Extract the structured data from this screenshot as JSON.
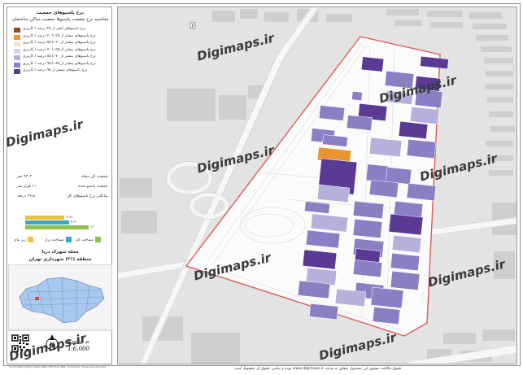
{
  "legend": {
    "title": "نرخ پاسیوهای جمعیت",
    "subtitle": "محاسبه نرخ جمعیت پاسیوها جمعیت ساکن ساختمان",
    "items": [
      {
        "label": "نرخ پاسیوهای کمتر از ۲۵ درصد / کاربری",
        "color": "#9a4a1a"
      },
      {
        "label": "نرخ پاسیوهای بیشتر از ۲۵ تا ۴۰ درصد / کاربری",
        "color": "#e8962e"
      },
      {
        "label": "نرخ پاسیوهای بیشتر از ۴۰ تا ۵۵ درصد / کاربری",
        "color": "#f3e6cf"
      },
      {
        "label": "نرخ پاسیوهای بیشتر از ۵۵ تا ۷۰ درصد / کاربری",
        "color": "#d7d4ea"
      },
      {
        "label": "نرخ پاسیوهای بیشتر از ۷۰ تا ۸۵ درصد / کاربری",
        "color": "#b6b1dc"
      },
      {
        "label": "نرخ پاسیوهای بیشتر از ۸۵ تا ۹۵ درصد / کاربری",
        "color": "#8a7fc2"
      },
      {
        "label": "نرخ پاسیوهای بیشتر از ۹۵ درصد / کاربری",
        "color": "#5a3a93"
      }
    ]
  },
  "stats": [
    {
      "key": "جمعیت کل محله",
      "value": "۹۴۰۲ نفر"
    },
    {
      "key": "جمعیت پاسیو شده",
      "value": "۱۱ هزار نفر"
    },
    {
      "key": "میانگین نرخ پاسیوهای کل",
      "value": "۶۹.۵ درصد"
    }
  ],
  "bars": [
    {
      "label": "۱۱",
      "value": 11,
      "color": "#8fc04a"
    },
    {
      "label": "۷.۶۰",
      "value": 7.6,
      "color": "#3aa6c8"
    },
    {
      "label": "۶.۸۱",
      "value": 6.81,
      "color": "#f0c040"
    }
  ],
  "bar_legend": [
    {
      "label": "مساحت کل",
      "color": "#8fc04a"
    },
    {
      "label": "مساحت تراز",
      "color": "#3aa6c8"
    },
    {
      "label": "زیر بنای",
      "color": "#f0c040"
    }
  ],
  "inset": {
    "title1": "محله شهرک دریا",
    "title2": "منطقه (۳۱) شهرداری تهران",
    "fill": "#a9c8ee"
  },
  "scale": "Scale = 1:6,000",
  "watermark": "Digimaps.ir",
  "footer": "حقوق مالکیت معنوی این محصول متعلق به سایت www.digimaps.ir بوده و تمامی حقوق آن محفوظ است.",
  "credit": "Coordinate System: WGS 1984 UTM Zone 39N · Projection: Transverse Mercator",
  "blocks": [
    {
      "color": "#5a3a93"
    },
    {
      "color": "#8a7fc2"
    },
    {
      "color": "#5a3a93"
    },
    {
      "color": "#b6b1dc"
    },
    {
      "color": "#8a7fc2"
    },
    {
      "color": "#8a7fc2"
    },
    {
      "color": "#5a3a93"
    },
    {
      "color": "#b6b1dc"
    },
    {
      "color": "#8a7fc2"
    },
    {
      "color": "#5a3a93"
    },
    {
      "color": "#8a7fc2"
    },
    {
      "color": "#8a7fc2"
    },
    {
      "color": "#b6b1dc"
    },
    {
      "color": "#8a7fc2"
    },
    {
      "color": "#e8962e"
    },
    {
      "color": "#8a7fc2"
    },
    {
      "color": "#8a7fc2"
    },
    {
      "color": "#5a3a93"
    },
    {
      "color": "#8a7fc2"
    },
    {
      "color": "#8a7fc2"
    },
    {
      "color": "#b6b1dc"
    },
    {
      "color": "#8a7fc2"
    },
    {
      "color": "#8a7fc2"
    },
    {
      "color": "#b6b1dc"
    },
    {
      "color": "#8a7fc2"
    },
    {
      "color": "#5a3a93"
    },
    {
      "color": "#8a7fc2"
    },
    {
      "color": "#8a7fc2"
    },
    {
      "color": "#b6b1dc"
    },
    {
      "color": "#5a3a93"
    },
    {
      "color": "#8a7fc2"
    },
    {
      "color": "#8a7fc2"
    },
    {
      "color": "#b6b1dc"
    },
    {
      "color": "#8a7fc2"
    },
    {
      "color": "#8a7fc2"
    },
    {
      "color": "#8a7fc2"
    },
    {
      "color": "#b6b1dc"
    },
    {
      "color": "#8a7fc2"
    },
    {
      "color": "#8a7fc2"
    },
    {
      "color": "#8a7fc2"
    },
    {
      "color": "#5a3a93"
    },
    {
      "color": "#8a7fc2"
    },
    {
      "color": "#8a7fc2"
    },
    {
      "color": "#5a3a93"
    }
  ]
}
